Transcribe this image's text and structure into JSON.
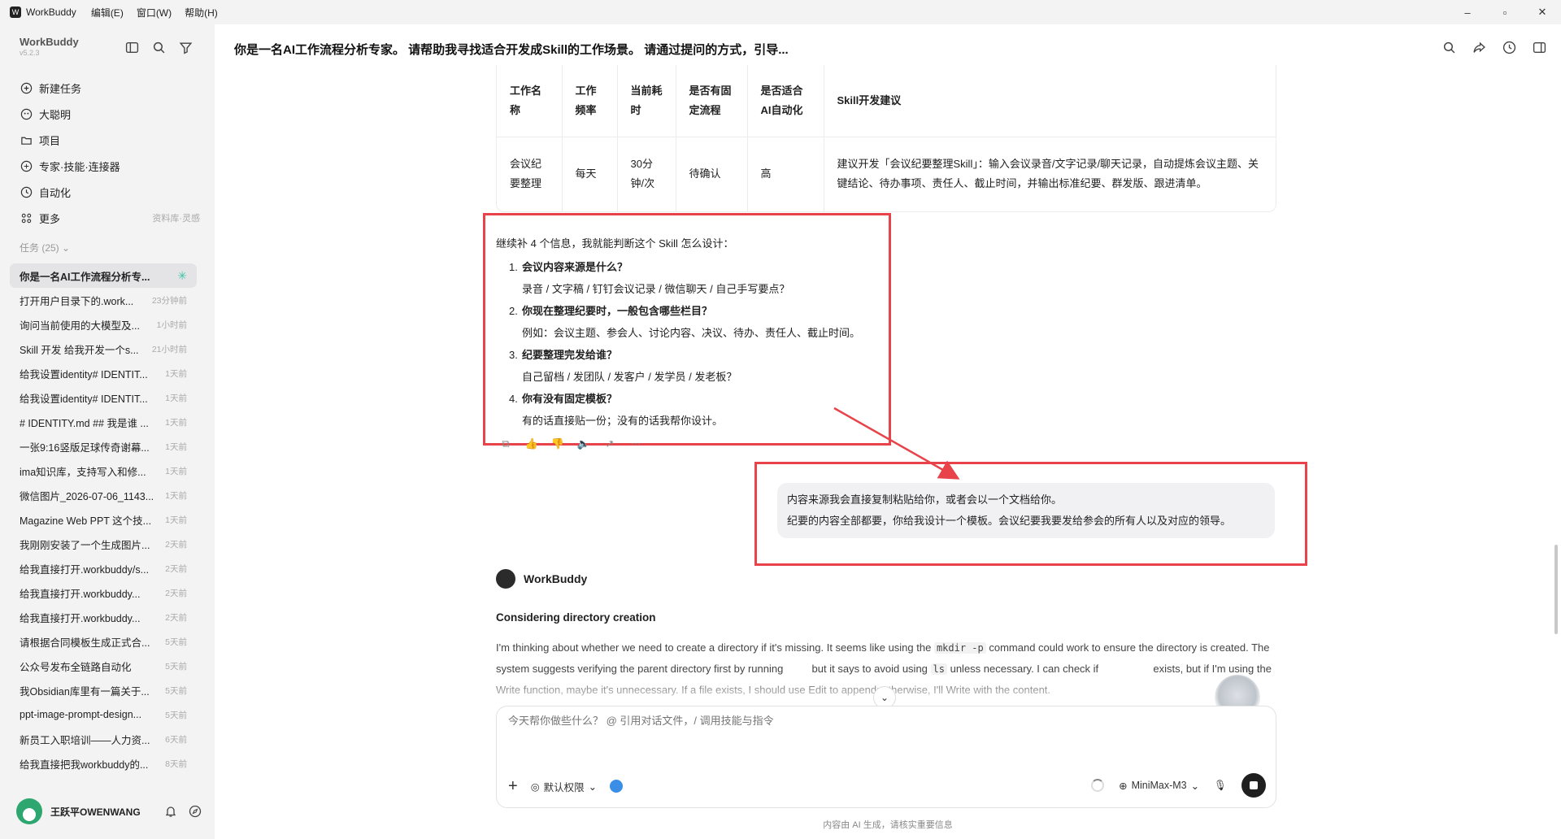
{
  "titlebar": {
    "app_name": "WorkBuddy",
    "menus": [
      "编辑(E)",
      "窗口(W)",
      "帮助(H)"
    ]
  },
  "sidebar": {
    "brand": "WorkBuddy",
    "version": "v5.2.3",
    "nav": [
      {
        "label": "新建任务",
        "icon": "plus-circle-icon"
      },
      {
        "label": "大聪明",
        "icon": "bot-icon"
      },
      {
        "label": "项目",
        "icon": "folder-icon"
      },
      {
        "label": "专家·技能·连接器",
        "icon": "puzzle-icon"
      },
      {
        "label": "自动化",
        "icon": "clock-icon"
      },
      {
        "label": "更多",
        "icon": "grid-icon",
        "extra": "资料库·灵感"
      }
    ],
    "tasks_header": "任务 (25)",
    "tasks": [
      {
        "title": "你是一名AI工作流程分析专...",
        "time": ""
      },
      {
        "title": "打开用户目录下的.work...",
        "time": "23分钟前"
      },
      {
        "title": "询问当前使用的大模型及...",
        "time": "1小时前"
      },
      {
        "title": "Skill 开发 给我开发一个s...",
        "time": "21小时前"
      },
      {
        "title": "给我设置identity# IDENTIT...",
        "time": "1天前"
      },
      {
        "title": "给我设置identity# IDENTIT...",
        "time": "1天前"
      },
      {
        "title": "# IDENTITY.md ## 我是谁 ...",
        "time": "1天前"
      },
      {
        "title": "一张9:16竖版足球传奇谢幕...",
        "time": "1天前"
      },
      {
        "title": "ima知识库，支持写入和修...",
        "time": "1天前"
      },
      {
        "title": "微信图片_2026-07-06_1143...",
        "time": "1天前"
      },
      {
        "title": "Magazine Web PPT 这个技...",
        "time": "1天前"
      },
      {
        "title": "我刚刚安装了一个生成图片...",
        "time": "2天前"
      },
      {
        "title": "给我直接打开.workbuddy/s...",
        "time": "2天前"
      },
      {
        "title": "给我直接打开.workbuddy...",
        "time": "2天前"
      },
      {
        "title": "给我直接打开.workbuddy...",
        "time": "2天前"
      },
      {
        "title": "请根据合同模板生成正式合...",
        "time": "5天前"
      },
      {
        "title": "公众号发布全链路自动化",
        "time": "5天前"
      },
      {
        "title": "我Obsidian库里有一篇关于...",
        "time": "5天前"
      },
      {
        "title": "ppt-image-prompt-design...",
        "time": "5天前"
      },
      {
        "title": "新员工入职培训——人力资...",
        "time": "6天前"
      },
      {
        "title": "给我直接把我workbuddy的...",
        "time": "8天前"
      }
    ],
    "user_name": "王跃平OWENWANG"
  },
  "main": {
    "title": "你是一名AI工作流程分析专家。 请帮助我寻找适合开发成Skill的工作场景。 请通过提问的方式，引导...",
    "table": {
      "headers": [
        "工作名称",
        "工作频率",
        "当前耗时",
        "是否有固定流程",
        "是否适合AI自动化",
        "Skill开发建议"
      ],
      "row": [
        "会议纪要整理",
        "每天",
        "30分钟/次",
        "待确认",
        "高",
        "建议开发「会议纪要整理Skill」：输入会议录音/文字记录/聊天记录，自动提炼会议主题、关键结论、待办事项、责任人、截止时间，并输出标准纪要、群发版、跟进清单。"
      ]
    },
    "reply_intro": "继续补 4 个信息，我就能判断这个 Skill 怎么设计：",
    "questions": [
      {
        "num": "1.",
        "q": "会议内容来源是什么？",
        "a": "录音 / 文字稿 / 钉钉会议记录 / 微信聊天 / 自己手写要点？"
      },
      {
        "num": "2.",
        "q": "你现在整理纪要时，一般包含哪些栏目？",
        "a": "例如：会议主题、参会人、讨论内容、决议、待办、责任人、截止时间。"
      },
      {
        "num": "3.",
        "q": "纪要整理完发给谁？",
        "a": "自己留档 / 发团队 / 发客户 / 发学员 / 发老板？"
      },
      {
        "num": "4.",
        "q": "你有没有固定模板？",
        "a": "有的话直接贴一份；没有的话我帮你设计。"
      }
    ],
    "user_message_lines": [
      "内容来源我会直接复制粘贴给你，或者会以一个文档给你。",
      "纪要的内容全部都要，你给我设计一个模板。会议纪要我要发给参会的所有人以及对应的领导。"
    ],
    "bot_name": "WorkBuddy",
    "thinking_title": "Considering directory creation",
    "thinking_parts": {
      "p1": "I'm thinking about whether we need to create a directory if it's missing. It seems like using the ",
      "c1": "mkdir -p",
      "p2": " command could work to ensure the directory is created. The system suggests verifying the parent directory first by running ",
      "p3": " but it says to avoid using ",
      "c2": "ls",
      "p4": " unless necessary. I can check if ",
      "p5": " exists, but if I'm using the Write function, maybe it's unnecessary. If a file exists, I should use Edit to append; otherwise, I'll Write with the content."
    },
    "composer_placeholder": "今天帮你做些什么？ @ 引用对话文件，/ 调用技能与指令",
    "permission_label": "默认权限",
    "model_label": "MiniMax-M3",
    "footer_note": "内容由 AI 生成，请核实重要信息"
  },
  "colors": {
    "highlight_red": "#e8434a",
    "accent_teal": "#3cc6a6"
  }
}
